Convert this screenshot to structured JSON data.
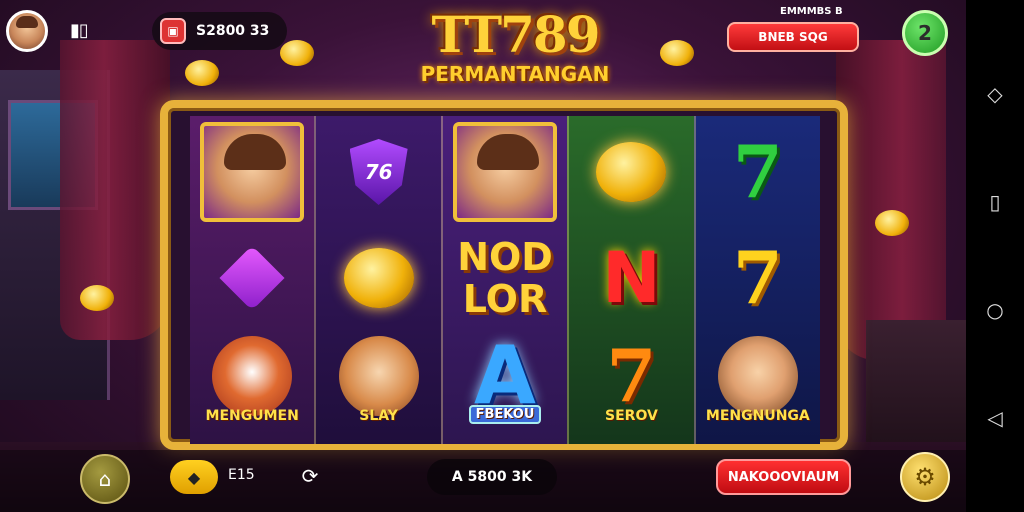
{
  "header": {
    "balance": "S2800 33",
    "promo_top": "EMMMBS B",
    "promo_button": "BNEB SQG",
    "level": "2"
  },
  "logo": {
    "title": "TT789",
    "subtitle": "PERMANTANGAN"
  },
  "reels": {
    "col0": {
      "bottom_label": "MENGUMEN"
    },
    "col1": {
      "shield_text": "76",
      "bottom_label": "SLAY"
    },
    "col2": {
      "word_line1": "NOD",
      "word_line2": "LOR",
      "gem_letter": "A",
      "bottom_label": "FBEKOU"
    },
    "col3": {
      "letter": "N",
      "bottom_label": "SEROV"
    },
    "col4": {
      "bottom_label": "MENGNUNGA"
    }
  },
  "footer": {
    "bet_value": "E15",
    "win_display": "A 5800 3K",
    "spin_label": "NAKOOOVIAUM"
  },
  "colors": {
    "frame_gold": "#e7b23a",
    "spin_red": "#c00c12",
    "level_green": "#1f9a22",
    "logo_yellow": "#ffd23a"
  },
  "icons": {
    "home": "home-icon",
    "settings": "gear-icon",
    "autoplay": "autoplay-icon",
    "nav_back": "back-icon",
    "nav_home": "circle-home-icon",
    "nav_recents": "square-recents-icon"
  }
}
